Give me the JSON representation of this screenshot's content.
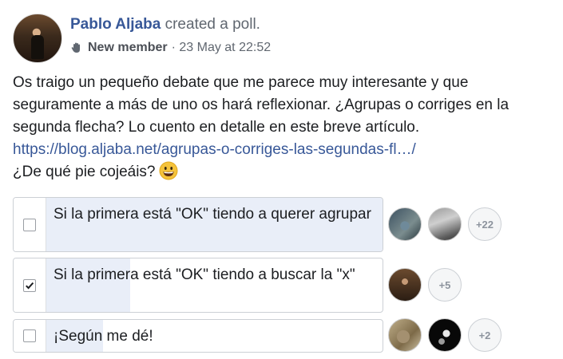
{
  "post": {
    "author": "Pablo Aljaba",
    "action": "created a poll.",
    "badge": "New member",
    "timestamp": "· 23 May at 22:52",
    "text_line1": "Os traigo un pequeño debate que me parece muy interesante y que",
    "text_line2": "seguramente a más de uno os hará reflexionar. ¿Agrupas o corriges en la",
    "text_line3": "segunda flecha? Lo cuento en detalle en este breve artículo.",
    "link": "https://blog.aljaba.net/agrupas-o-corriges-las-segundas-fl…/",
    "question": "¿De qué pie cojeáis?"
  },
  "poll": {
    "options": [
      {
        "label": "Si la primera está \"OK\" tiendo a querer agrupar",
        "checked": false,
        "fill_fraction": 1.0,
        "more_count": "+22"
      },
      {
        "label": "Si la primera está \"OK\" tiendo a buscar la \"x\"",
        "checked": true,
        "fill_fraction": 0.25,
        "more_count": "+5"
      },
      {
        "label": "¡Según me dé!",
        "checked": false,
        "fill_fraction": 0.17,
        "more_count": "+2"
      }
    ]
  },
  "colors": {
    "link": "#385898",
    "fill": "#e9eef8",
    "border": "#ccd0d5"
  }
}
